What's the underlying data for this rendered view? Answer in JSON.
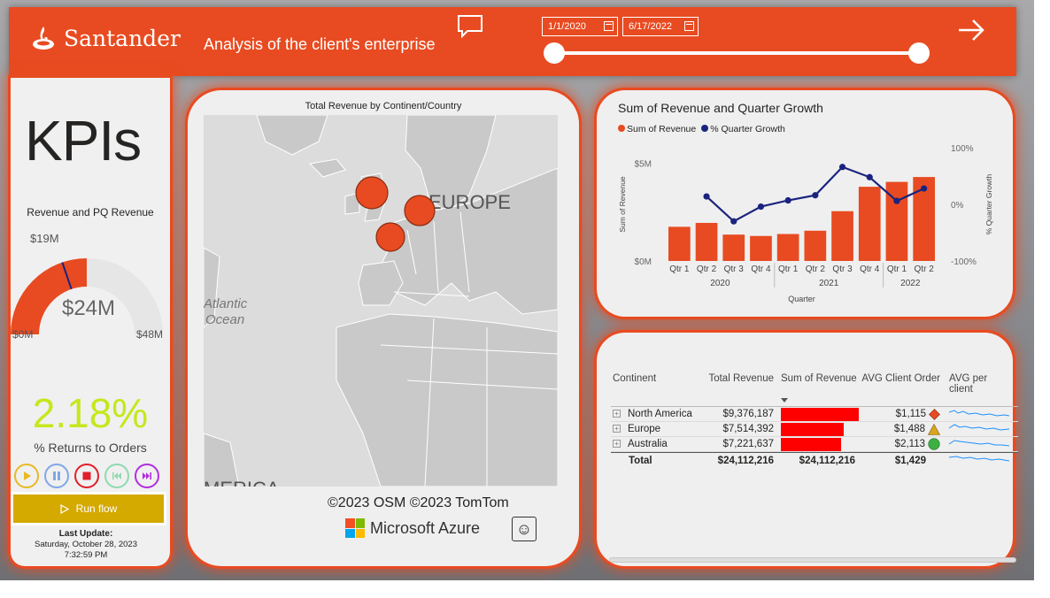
{
  "header": {
    "brand": "Santander",
    "subtitle": "Analysis of the client's enterprise",
    "date_start": "1/1/2020",
    "date_end": "6/17/2022",
    "icons": {
      "chat": "comment-icon",
      "next": "arrow-right-icon",
      "calendar": "calendar-icon"
    }
  },
  "kpi": {
    "title": "KPIs",
    "gauge_title": "Revenue and PQ Revenue",
    "gauge_value": "$24M",
    "gauge_target": "$19M",
    "gauge_min": "$0M",
    "gauge_max": "$48M",
    "gauge_value_num": 24,
    "gauge_target_num": 19,
    "gauge_max_num": 48,
    "returns_pct": "2.18%",
    "returns_label": "% Returns to Orders",
    "run_flow": "Run flow",
    "last_update_label": "Last Update:",
    "last_update_date": "Saturday, October 28, 2023",
    "last_update_time": "7:32:59 PM",
    "controls": [
      "play-icon",
      "pause-icon",
      "stop-icon",
      "rewind-icon",
      "fast-forward-icon"
    ]
  },
  "map": {
    "title": "Total Revenue by Continent/Country",
    "labels": {
      "europe": "EUROPE",
      "atlantic_1": "Atlantic",
      "atlantic_2": "Ocean",
      "america": "MERICA"
    },
    "attribution": "©2023 OSM  ©2023 TomTom",
    "provider": "Microsoft Azure"
  },
  "chart": {
    "title": "Sum of Revenue and Quarter Growth",
    "legend_revenue": "Sum of Revenue",
    "legend_growth": "% Quarter Growth"
  },
  "chart_data": {
    "type": "bar",
    "title": "Sum of Revenue and Quarter Growth",
    "xlabel": "Quarter",
    "ylabel": "Sum of Revenue",
    "y2label": "% Quarter Growth",
    "categories": [
      "Qtr 1",
      "Qtr 2",
      "Qtr 3",
      "Qtr 4",
      "Qtr 1",
      "Qtr 2",
      "Qtr 3",
      "Qtr 4",
      "Qtr 1",
      "Qtr 2"
    ],
    "years": [
      {
        "label": "2020",
        "span": 4
      },
      {
        "label": "2021",
        "span": 4
      },
      {
        "label": "2022",
        "span": 2
      }
    ],
    "ylim": [
      0,
      5.8
    ],
    "y_ticks": [
      "$0M",
      "$5M"
    ],
    "y2lim": [
      -100,
      100
    ],
    "y2_ticks": [
      "-100%",
      "0%",
      "100%"
    ],
    "series": [
      {
        "name": "Sum of Revenue",
        "kind": "bar",
        "color": "#e84b21",
        "values": [
          1.75,
          1.95,
          1.35,
          1.28,
          1.38,
          1.55,
          2.55,
          3.8,
          4.05,
          4.3
        ]
      },
      {
        "name": "% Quarter Growth",
        "kind": "line",
        "color": "#1a237e",
        "values": [
          null,
          14,
          -30,
          -4,
          7,
          16,
          66,
          48,
          6,
          28
        ]
      }
    ]
  },
  "table": {
    "headers": [
      "Continent",
      "Total Revenue",
      "Sum of Revenue",
      "AVG Client Order",
      "AVG per client"
    ],
    "rows": [
      {
        "continent": "North America",
        "total": "$9,376,187",
        "sum": 9376187,
        "avg": "$1,115",
        "shape": "diamond",
        "color": "#e84b21"
      },
      {
        "continent": "Europe",
        "total": "$7,514,392",
        "sum": 7514392,
        "avg": "$1,488",
        "shape": "triangle",
        "color": "#d9a520"
      },
      {
        "continent": "Australia",
        "total": "$7,221,637",
        "sum": 7221637,
        "avg": "$2,113",
        "shape": "circle",
        "color": "#3cb043"
      }
    ],
    "total": {
      "label": "Total",
      "total": "$24,112,216",
      "sum": "$24,112,216",
      "avg": "$1,429"
    }
  },
  "colors": {
    "brand": "#e84b21",
    "accent_green": "#c4e81c",
    "run_flow": "#d4a900",
    "bar_red": "#ff0000",
    "line_navy": "#1a237e"
  }
}
